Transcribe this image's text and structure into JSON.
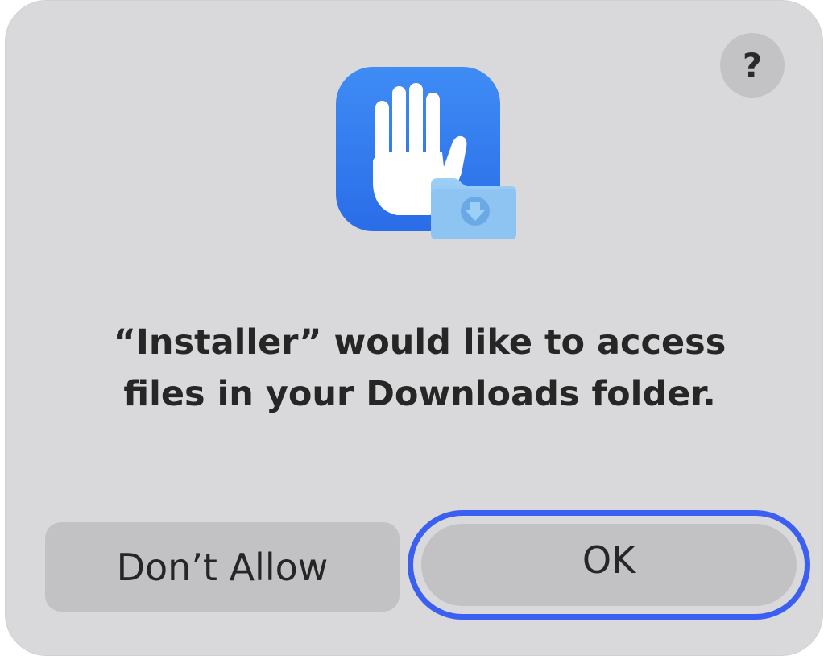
{
  "dialog": {
    "help_label": "?",
    "message_line1": "“Installer” would like to access",
    "message_line2": "files in your Downloads folder.",
    "buttons": {
      "dont_allow": "Don’t Allow",
      "ok": "OK"
    },
    "icon": "privacy-hand-icon",
    "badge_icon": "downloads-folder-icon"
  },
  "colors": {
    "dialog_bg": "#d9d9db",
    "button_bg": "#c2c2c4",
    "focus_ring": "#3b5ff0",
    "icon_blue": "#3476f0",
    "folder_blue": "#8fc6f2"
  }
}
